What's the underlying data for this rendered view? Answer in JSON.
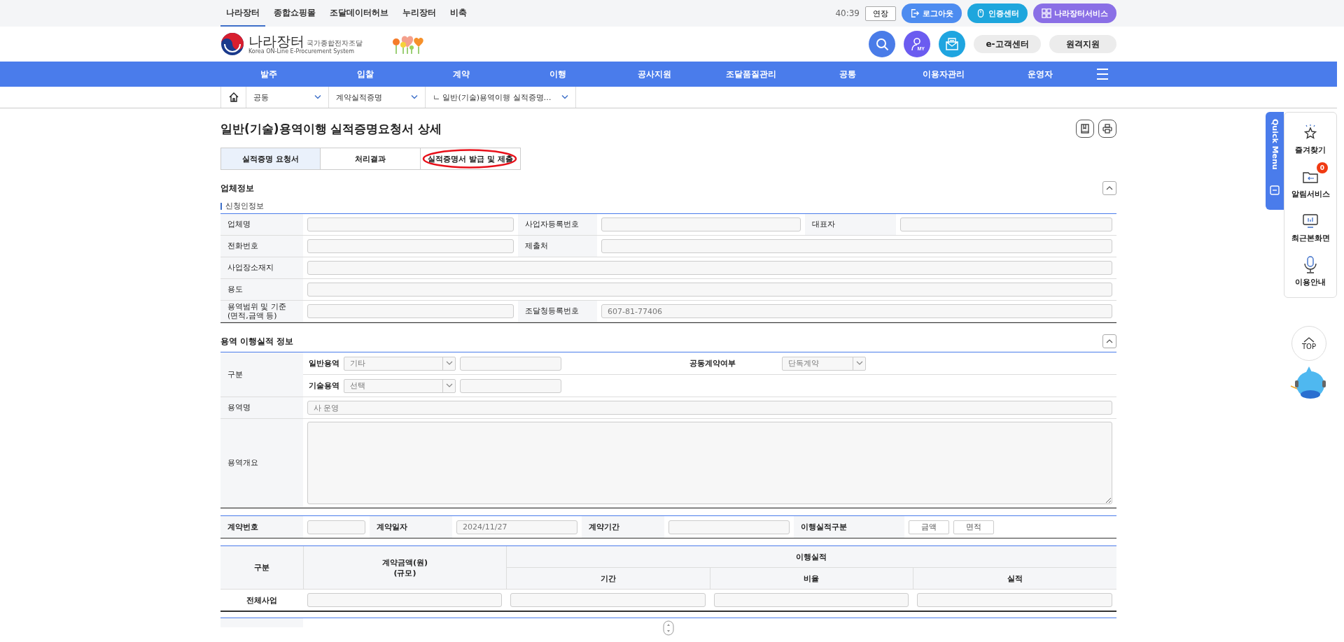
{
  "top_bar": {
    "links": [
      {
        "label": "나라장터",
        "selected": true
      },
      {
        "label": "종합쇼핑몰",
        "selected": false
      },
      {
        "label": "조달데이터허브",
        "selected": false
      },
      {
        "label": "누리장터",
        "selected": false
      },
      {
        "label": "비축",
        "selected": false
      }
    ],
    "timer": "40:39",
    "extend_button": "연장",
    "buttons": [
      {
        "label": "로그아웃",
        "kind": "logout"
      },
      {
        "label": "인증센터",
        "kind": "cert"
      },
      {
        "label": "나라장터서비스",
        "kind": "service"
      }
    ]
  },
  "header": {
    "logo_title": "나라장터",
    "logo_subtitle": "국가종합전자조달",
    "logo_english": "Korea ON-Line E-Procurement System",
    "icon_buttons": [
      {
        "kind": "search"
      },
      {
        "kind": "my",
        "label": "MY"
      },
      {
        "kind": "mail"
      }
    ],
    "buttons": [
      "e-고객센터",
      "원격지원"
    ]
  },
  "nav": {
    "items": [
      "발주",
      "입찰",
      "계약",
      "이행",
      "공사지원",
      "조달품질관리",
      "공통",
      "이용자관리",
      "운영자"
    ]
  },
  "breadcrumb": [
    "공동",
    "계약실적증명",
    "ㄴ 일반(기술)용역이행 실적증명…"
  ],
  "page_title": "일반(기술)용역이행 실적증명요청서 상세",
  "tabs": [
    {
      "label": "실적증명 요청서",
      "selected": true,
      "circled": false
    },
    {
      "label": "처리결과",
      "selected": false,
      "circled": false
    },
    {
      "label": "실적증명서 발급 및 제출",
      "selected": false,
      "circled": true
    }
  ],
  "company_section": {
    "title": "업체정보",
    "subtitle": "신청인정보",
    "rows": [
      [
        {
          "label": "업체명"
        },
        {
          "label": "사업자등록번호"
        },
        {
          "label": "대표자"
        }
      ],
      [
        {
          "label": "전화번호"
        },
        {
          "label": "제출처"
        }
      ],
      [
        {
          "label": "사업장소재지"
        }
      ],
      [
        {
          "label": "용도"
        }
      ],
      [
        {
          "label": "용역범위 및 기준\n(면적,금액 등)"
        },
        {
          "label": "조달청등록번호",
          "value": "607-81-77406"
        }
      ]
    ]
  },
  "service_section": {
    "title": "용역 이행실적 정보",
    "category_label": "구분",
    "general": {
      "label": "일반용역",
      "select": "기타"
    },
    "joint": {
      "label": "공동계약여부",
      "select": "단독계약"
    },
    "tech": {
      "label": "기술용역",
      "select": "선택"
    },
    "name": {
      "label": "용역명",
      "value": "사 운영"
    },
    "summary": {
      "label": "용역개요"
    }
  },
  "contract_row": {
    "number_label": "계약번호",
    "date_label": "계약일자",
    "date": "2024/11/27",
    "period_label": "계약기간",
    "type_label": "이행실적구분",
    "type_buttons": [
      "금액",
      "면적"
    ]
  },
  "performance_table": {
    "category": "구분",
    "amount": "계약금액(원)\n(규모)",
    "group": "이행실적",
    "columns": [
      "기간",
      "비율",
      "실적"
    ],
    "row_label": "전체사업"
  },
  "quick_menu": {
    "title": "Quick Menu",
    "items": [
      {
        "label": "즐겨찾기",
        "kind": "star"
      },
      {
        "label": "알림서비스",
        "kind": "folder",
        "badge": "0"
      },
      {
        "label": "최근본화면",
        "kind": "monitor"
      },
      {
        "label": "이용안내",
        "kind": "mic"
      }
    ],
    "top_button": "TOP"
  }
}
